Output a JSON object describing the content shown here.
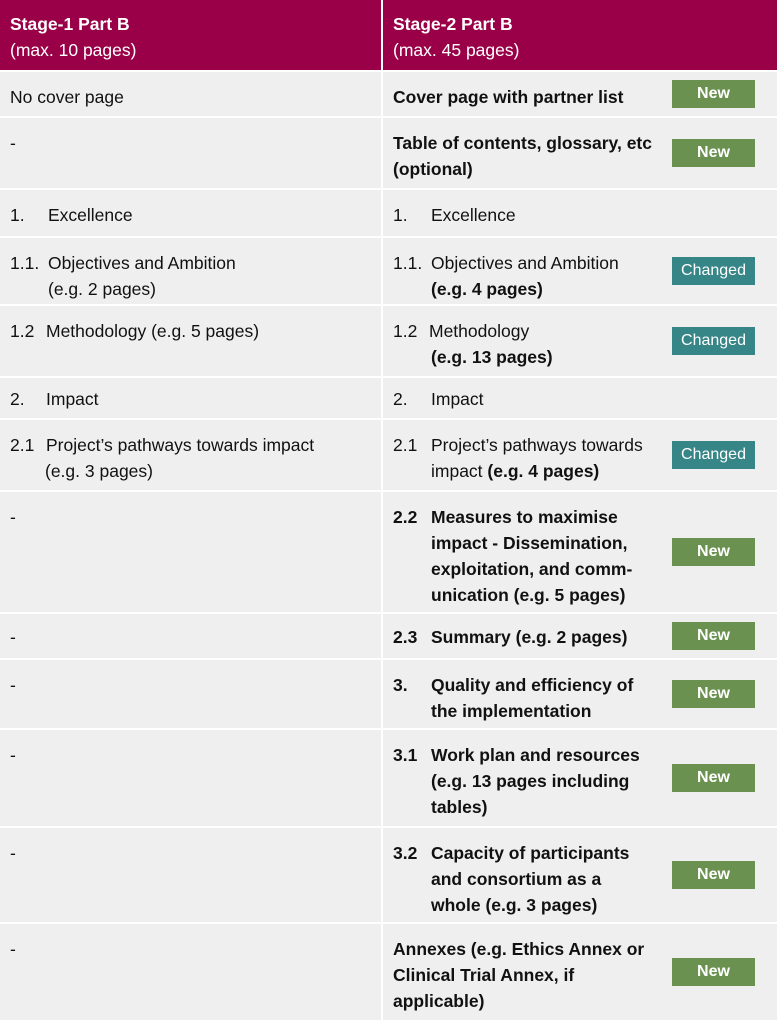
{
  "header": {
    "col1": {
      "title": "Stage-1 Part B",
      "subtitle": "(max. 10 pages)"
    },
    "col2": {
      "title": "Stage-2 Part B",
      "subtitle": "(max. 45 pages)"
    }
  },
  "badges": {
    "new": "New",
    "changed": "Changed"
  },
  "colors": {
    "header_bg": "#990047",
    "cell_bg": "#efefef",
    "new_badge": "#6a914f",
    "changed_badge": "#368587"
  },
  "rows": [
    {
      "left": "No cover page",
      "right": "Cover page with partner list",
      "badge": "New"
    },
    {
      "left": "-",
      "right": "Table of contents, glossary, etc (optional)",
      "badge": "New"
    },
    {
      "left_num": "1.",
      "left": "Excellence",
      "right_num": "1.",
      "right": "Excellence"
    },
    {
      "left_num": "1.1.",
      "left": "Objectives and Ambition",
      "left_sub": "(e.g. 2 pages)",
      "right_num": "1.1.",
      "right": "Objectives and Ambition",
      "right_sub": "(e.g. 4 pages)",
      "badge": "Changed"
    },
    {
      "left_num": "1.2",
      "left": "Methodology (e.g. 5 pages)",
      "right_num": "1.2",
      "right": "Methodology",
      "right_sub": "(e.g. 13 pages)",
      "badge": "Changed"
    },
    {
      "left_num": "2.",
      "left": "Impact",
      "right_num": "2.",
      "right": "Impact"
    },
    {
      "left_num": "2.1",
      "left": "Project’s pathways towards impact",
      "left_sub": "(e.g. 3 pages)",
      "right_num": "2.1",
      "right": "Project’s pathways towards impact",
      "right_sub": "(e.g. 4 pages)",
      "badge": "Changed"
    },
    {
      "left": "-",
      "right_num": "2.2",
      "right": "Measures to maximise impact - Dissemination, exploitation, and comm-unication (e.g. 5 pages)",
      "badge": "New"
    },
    {
      "left": "-",
      "right_num": "2.3",
      "right": "Summary (e.g. 2 pages)",
      "badge": "New"
    },
    {
      "left": "-",
      "right_num": "3.",
      "right": "Quality and efficiency of the implementation",
      "badge": "New"
    },
    {
      "left": "-",
      "right_num": "3.1",
      "right": "Work plan and resources (e.g. 13 pages including tables)",
      "badge": "New"
    },
    {
      "left": "-",
      "right_num": "3.2",
      "right": "Capacity of participants and consortium as a whole (e.g. 3 pages)",
      "badge": "New"
    },
    {
      "left": "-",
      "right": "Annexes (e.g. Ethics Annex or Clinical Trial Annex, if applicable)",
      "badge": "New"
    }
  ]
}
